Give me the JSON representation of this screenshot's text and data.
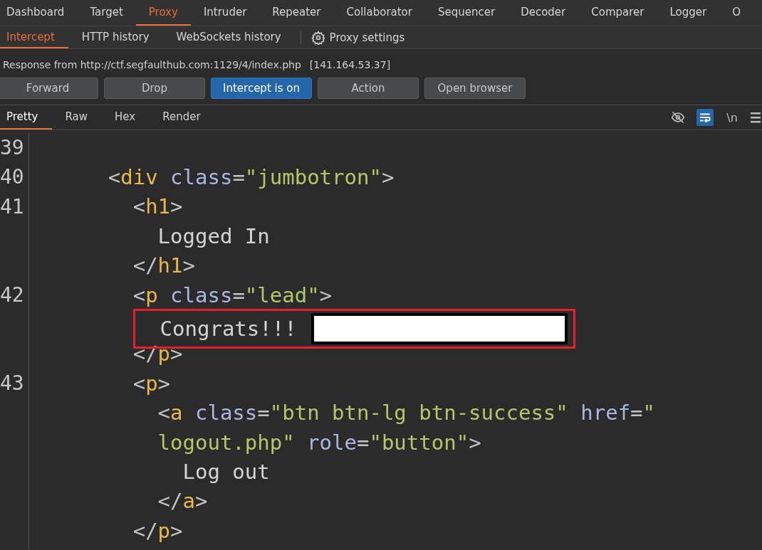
{
  "main_tabs": [
    {
      "label": "Dashboard",
      "selected": false
    },
    {
      "label": "Target",
      "selected": false
    },
    {
      "label": "Proxy",
      "selected": true
    },
    {
      "label": "Intruder",
      "selected": false
    },
    {
      "label": "Repeater",
      "selected": false
    },
    {
      "label": "Collaborator",
      "selected": false
    },
    {
      "label": "Sequencer",
      "selected": false
    },
    {
      "label": "Decoder",
      "selected": false
    },
    {
      "label": "Comparer",
      "selected": false
    },
    {
      "label": "Logger",
      "selected": false
    },
    {
      "label": "O",
      "selected": false
    }
  ],
  "sub_tabs": [
    {
      "label": "Intercept",
      "selected": true
    },
    {
      "label": "HTTP history",
      "selected": false
    },
    {
      "label": "WebSockets history",
      "selected": false
    }
  ],
  "settings_link": "Proxy settings",
  "response_info": {
    "text": "Response from http://ctf.segfaulthub.com:1129/4/index.php",
    "address": "[141.164.53.37]"
  },
  "buttons": [
    {
      "label": "Forward",
      "selected": false
    },
    {
      "label": "Drop",
      "selected": false
    },
    {
      "label": "Intercept is on",
      "selected": true
    },
    {
      "label": "Action",
      "selected": false
    },
    {
      "label": "Open browser",
      "selected": false
    }
  ],
  "view_tabs": [
    {
      "label": "Pretty",
      "selected": true
    },
    {
      "label": "Raw",
      "selected": false
    },
    {
      "label": "Hex",
      "selected": false
    },
    {
      "label": "Render",
      "selected": false
    }
  ],
  "view_tools": {
    "hide_nonprintable": false,
    "wrap_lines": true,
    "newline_label": "\\n"
  },
  "code_lines": [
    {
      "number": "39"
    },
    {
      "number": "40",
      "tokens": [
        {
          "kind": "punct",
          "text": "      <"
        },
        {
          "kind": "tag",
          "text": "div"
        },
        {
          "kind": "attr",
          "text": " class"
        },
        {
          "kind": "punct",
          "text": "="
        },
        {
          "kind": "string",
          "text": "\"jumbotron\""
        },
        {
          "kind": "punct",
          "text": ">"
        }
      ]
    },
    {
      "number": "41",
      "tokens": [
        {
          "kind": "punct",
          "text": "        <"
        },
        {
          "kind": "tag",
          "text": "h1"
        },
        {
          "kind": "punct",
          "text": ">"
        }
      ]
    },
    {
      "tokens": [
        {
          "kind": "text",
          "text": "          Logged In"
        }
      ]
    },
    {
      "tokens": [
        {
          "kind": "punct",
          "text": "        </"
        },
        {
          "kind": "tag",
          "text": "h1"
        },
        {
          "kind": "punct",
          "text": ">"
        }
      ]
    },
    {
      "number": "42",
      "tokens": [
        {
          "kind": "punct",
          "text": "        <"
        },
        {
          "kind": "tag",
          "text": "p"
        },
        {
          "kind": "attr",
          "text": " class"
        },
        {
          "kind": "punct",
          "text": "="
        },
        {
          "kind": "string",
          "text": "\"lead\""
        },
        {
          "kind": "punct",
          "text": ">"
        }
      ]
    },
    {
      "highlighted": true,
      "redacted": true,
      "tokens": [
        {
          "kind": "text",
          "text": "Congrats!!!"
        }
      ]
    },
    {
      "tokens": [
        {
          "kind": "punct",
          "text": "        </"
        },
        {
          "kind": "tag",
          "text": "p"
        },
        {
          "kind": "punct",
          "text": ">"
        }
      ]
    },
    {
      "number": "43",
      "tokens": [
        {
          "kind": "punct",
          "text": "        <"
        },
        {
          "kind": "tag",
          "text": "p"
        },
        {
          "kind": "punct",
          "text": ">"
        }
      ]
    },
    {
      "tokens": [
        {
          "kind": "punct",
          "text": "          <"
        },
        {
          "kind": "tag",
          "text": "a"
        },
        {
          "kind": "attr",
          "text": " class"
        },
        {
          "kind": "punct",
          "text": "="
        },
        {
          "kind": "string",
          "text": "\"btn btn-lg btn-success\""
        },
        {
          "kind": "attr",
          "text": " href"
        },
        {
          "kind": "punct",
          "text": "="
        },
        {
          "kind": "string",
          "text": "\""
        }
      ]
    },
    {
      "tokens": [
        {
          "kind": "string",
          "text": "          logout.php\""
        },
        {
          "kind": "attr",
          "text": " role"
        },
        {
          "kind": "punct",
          "text": "="
        },
        {
          "kind": "string",
          "text": "\"button\""
        },
        {
          "kind": "punct",
          "text": ">"
        }
      ]
    },
    {
      "tokens": [
        {
          "kind": "text",
          "text": "            Log out"
        }
      ]
    },
    {
      "tokens": [
        {
          "kind": "punct",
          "text": "          </"
        },
        {
          "kind": "tag",
          "text": "a"
        },
        {
          "kind": "punct",
          "text": ">"
        }
      ]
    },
    {
      "tokens": [
        {
          "kind": "punct",
          "text": "        </"
        },
        {
          "kind": "tag",
          "text": "p"
        },
        {
          "kind": "punct",
          "text": ">"
        }
      ]
    }
  ]
}
